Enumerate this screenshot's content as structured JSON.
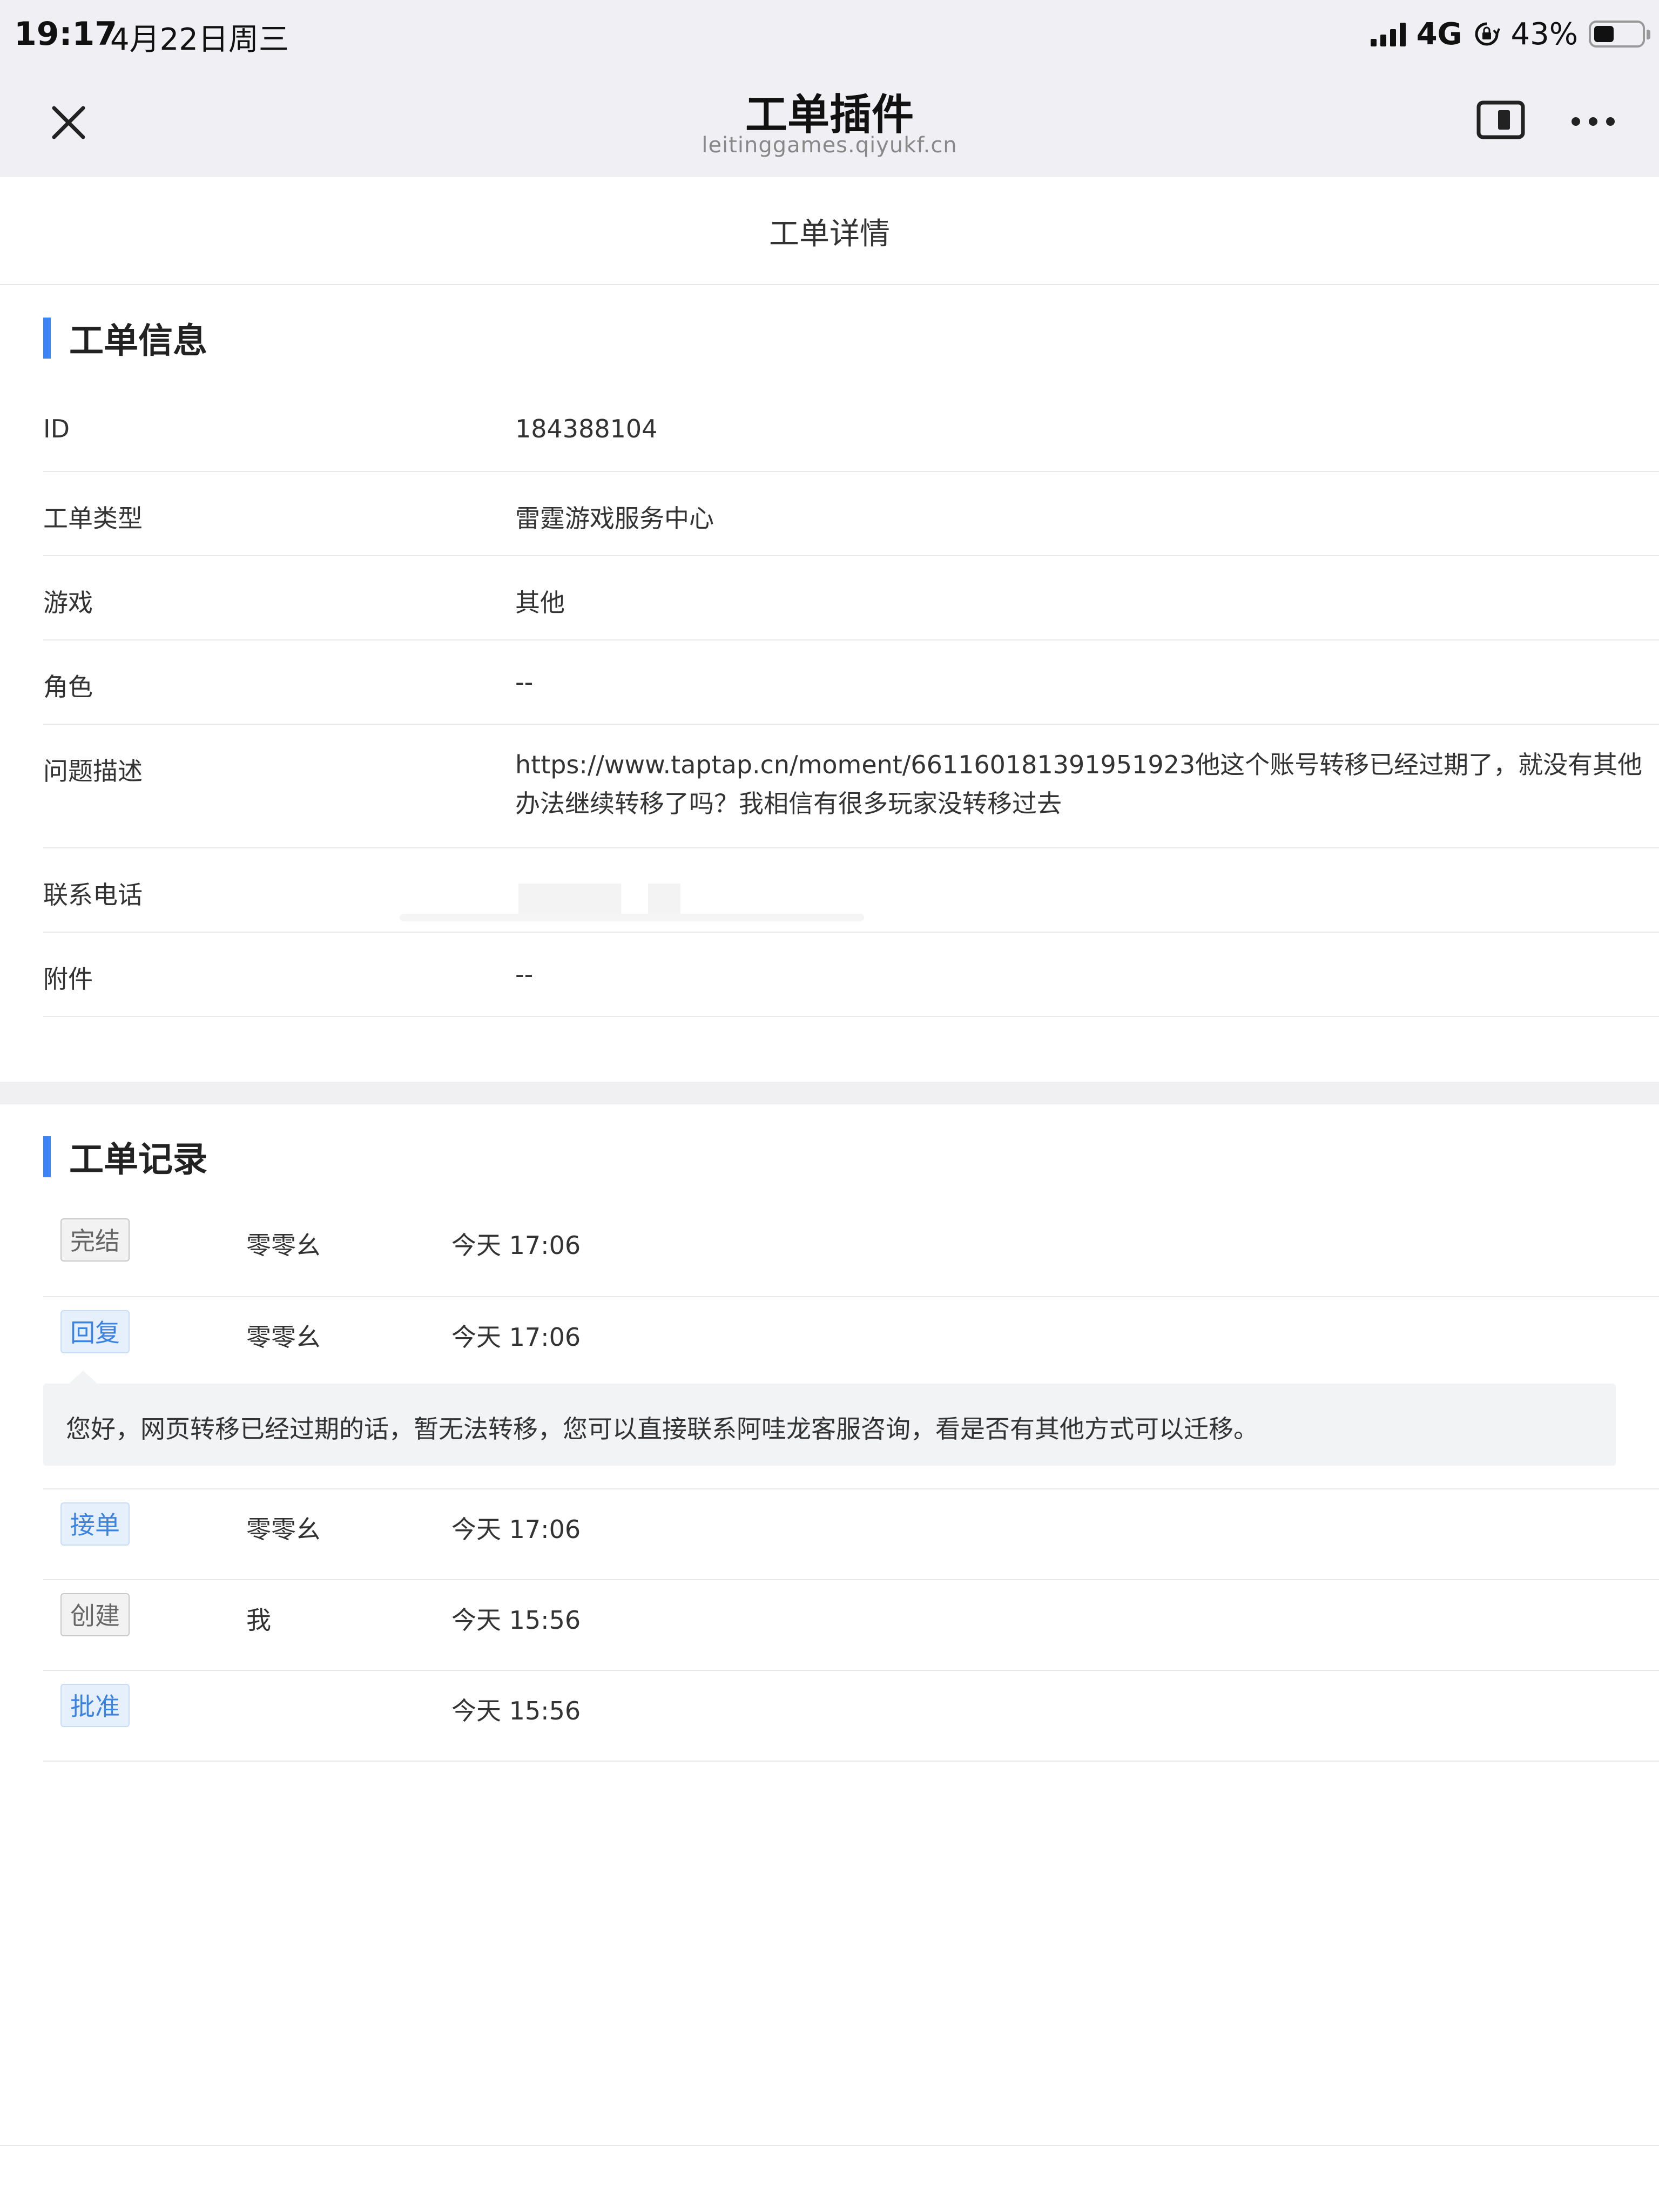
{
  "status_bar": {
    "time": "19:17",
    "date": "4月22日周三",
    "network": "4G",
    "battery_pct": "43%",
    "battery_level": 0.43,
    "icons": [
      "signal-icon",
      "rotation-lock-icon",
      "battery-icon"
    ]
  },
  "nav": {
    "title": "工单插件",
    "subtitle": "leitinggames.qiyukf.cn",
    "icons": [
      "close-icon",
      "window-icon",
      "more-icon"
    ]
  },
  "header": {
    "title": "工单详情"
  },
  "info_section": {
    "title": "工单信息",
    "rows": [
      {
        "label": "ID",
        "value": "184388104"
      },
      {
        "label": "工单类型",
        "value": "雷霆游戏服务中心"
      },
      {
        "label": "游戏",
        "value": "其他"
      },
      {
        "label": "角色",
        "value": "--"
      },
      {
        "label": "问题描述",
        "value": "https://www.taptap.cn/moment/661160181391951923他这个账号转移已经过期了，就没有其他办法继续转移了吗？我相信有很多玩家没转移过去"
      },
      {
        "label": "联系电话",
        "value": ""
      },
      {
        "label": "附件",
        "value": "--"
      }
    ]
  },
  "records_section": {
    "title": "工单记录",
    "records": [
      {
        "tag": "完结",
        "style": "gray",
        "name": "零零幺",
        "time": "今天 17:06"
      },
      {
        "tag": "回复",
        "style": "blue",
        "name": "零零幺",
        "time": "今天 17:06",
        "content": "您好，网页转移已经过期的话，暂无法转移，您可以直接联系阿哇龙客服咨询，看是否有其他方式可以迁移。"
      },
      {
        "tag": "接单",
        "style": "blue",
        "name": "零零幺",
        "time": "今天 17:06"
      },
      {
        "tag": "创建",
        "style": "gray",
        "name": "我",
        "time": "今天 15:56"
      },
      {
        "tag": "批准",
        "style": "blue",
        "name": "",
        "time": "今天 15:56"
      }
    ]
  },
  "colors": {
    "accent": "#3c83f6",
    "tag_blue_text": "#3b83e0",
    "tag_blue_bg": "#e6f0fc",
    "tag_gray_text": "#666666",
    "tag_gray_bg": "#f2f2f2",
    "top_bar_bg": "#efeff4"
  }
}
